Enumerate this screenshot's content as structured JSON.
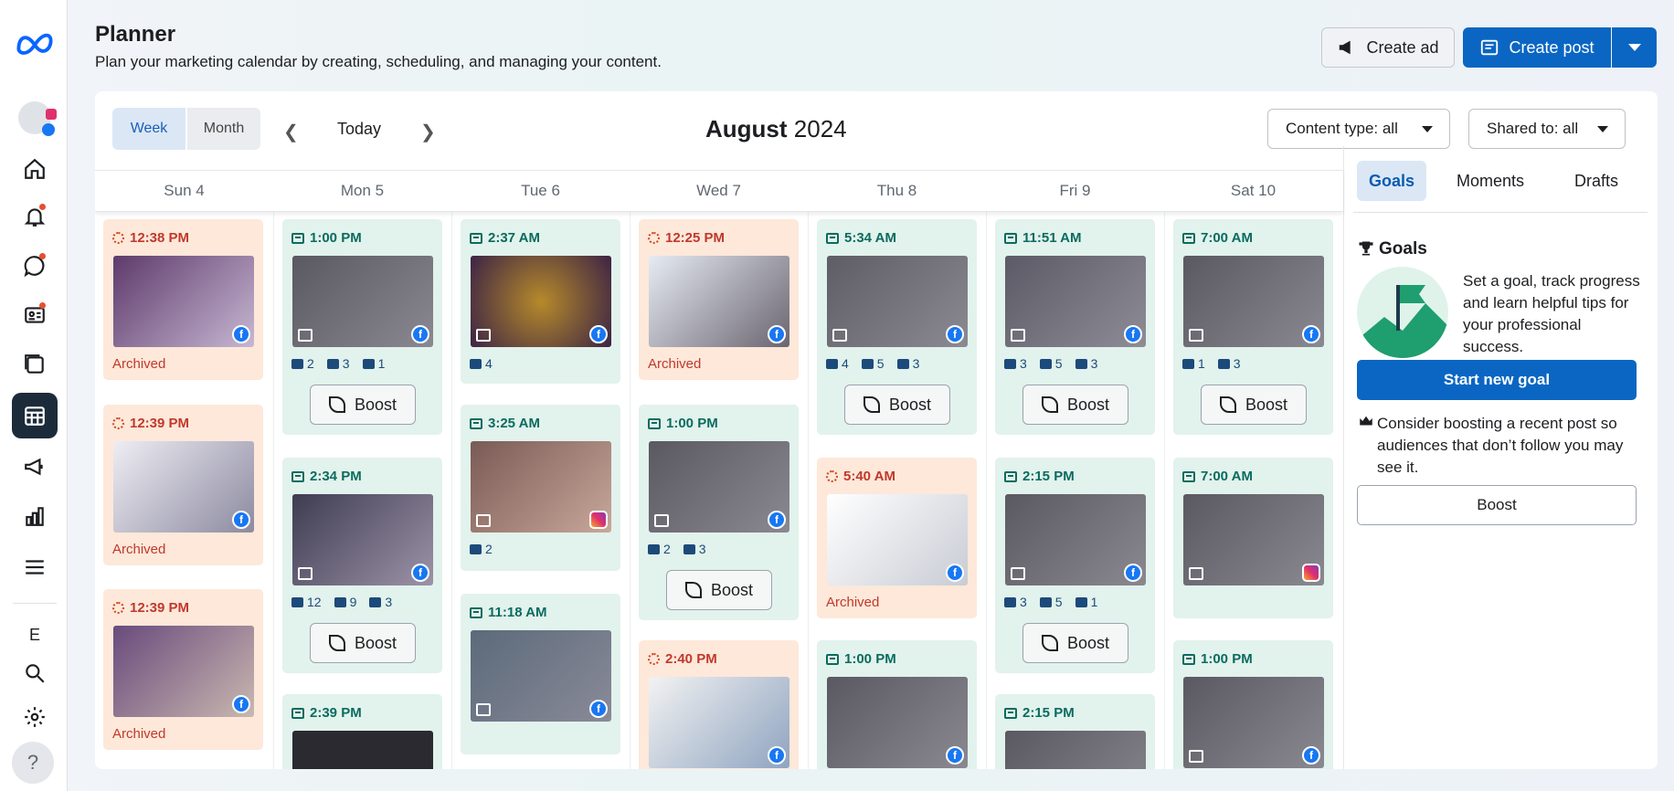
{
  "header": {
    "title": "Planner",
    "subtitle": "Plan your marketing calendar by creating, scheduling, and managing your content.",
    "create_ad": "Create ad",
    "create_post": "Create post"
  },
  "rail": {
    "letter": "E",
    "help": "?"
  },
  "toolbar": {
    "week": "Week",
    "month": "Month",
    "today": "Today",
    "month_name": "August",
    "year": " 2024",
    "content_type": "Content type: all",
    "shared_to": "Shared to: all"
  },
  "days": [
    "Sun 4",
    "Mon 5",
    "Tue 6",
    "Wed 7",
    "Thu 8",
    "Fri 9",
    "Sat 10"
  ],
  "cards": {
    "sun": [
      {
        "time": "12:38 PM",
        "status": "Archived"
      },
      {
        "time": "12:39 PM",
        "status": "Archived"
      },
      {
        "time": "12:39 PM",
        "status": "Archived"
      }
    ],
    "mon": [
      {
        "time": "1:00 PM",
        "likes": "2",
        "comments": "3",
        "shares": "1",
        "boost": "Boost"
      },
      {
        "time": "2:34 PM",
        "likes": "12",
        "comments": "9",
        "shares": "3",
        "boost": "Boost"
      },
      {
        "time": "2:39 PM"
      }
    ],
    "tue": [
      {
        "time": "2:37 AM",
        "likes": "4"
      },
      {
        "time": "3:25 AM",
        "likes": "2"
      },
      {
        "time": "11:18 AM"
      }
    ],
    "wed": [
      {
        "time": "12:25 PM",
        "status": "Archived"
      },
      {
        "time": "1:00 PM",
        "likes": "2",
        "comments": "3",
        "boost": "Boost"
      },
      {
        "time": "2:40 PM"
      }
    ],
    "thu": [
      {
        "time": "5:34 AM",
        "likes": "4",
        "comments": "5",
        "shares": "3",
        "boost": "Boost"
      },
      {
        "time": "5:40 AM",
        "status": "Archived"
      },
      {
        "time": "1:00 PM"
      }
    ],
    "fri": [
      {
        "time": "11:51 AM",
        "likes": "3",
        "comments": "5",
        "shares": "3",
        "boost": "Boost"
      },
      {
        "time": "2:15 PM",
        "likes": "3",
        "comments": "5",
        "shares": "1",
        "boost": "Boost"
      },
      {
        "time": "2:15 PM"
      }
    ],
    "sat": [
      {
        "time": "7:00 AM",
        "likes": "1",
        "comments": "3",
        "boost": "Boost"
      },
      {
        "time": "7:00 AM"
      },
      {
        "time": "1:00 PM"
      }
    ]
  },
  "right_panel": {
    "tabs": [
      "Goals",
      "Moments",
      "Drafts"
    ],
    "goals_title": "Goals",
    "goals_desc": "Set a goal, track progress and learn helpful tips for your professional success.",
    "start_goal": "Start new goal",
    "boost_tip": "Consider boosting a recent post so audiences that don’t follow you may see it.",
    "boost": "Boost"
  },
  "colors": {
    "accent": "#0a66c2",
    "published_bg": "#e2f2ec",
    "archived_bg": "#fde8da"
  }
}
